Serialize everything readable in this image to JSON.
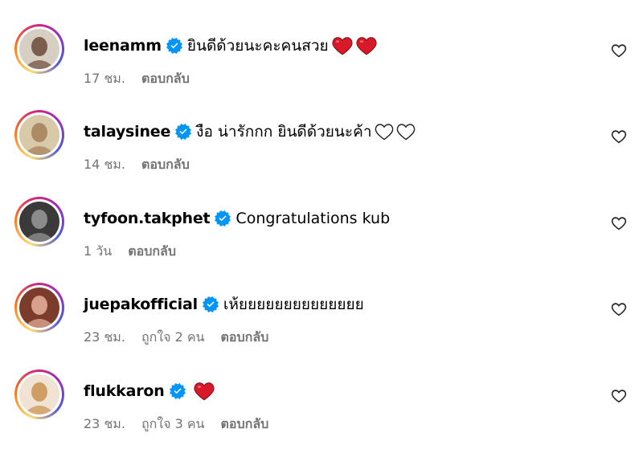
{
  "comments": [
    {
      "username": "leenamm",
      "text": "ยินดีด้วยนะคะคนสวย",
      "red_hearts": 2,
      "white_hearts": 0,
      "time": "17 ชม.",
      "likes": "",
      "reply": "ตอบกลับ",
      "avatar_colors": [
        "#d8cfc4",
        "#6b4a3a"
      ]
    },
    {
      "username": "talaysinee",
      "text": "งือ น่ารักกก ยินดีด้วยนะค้า",
      "red_hearts": 0,
      "white_hearts": 2,
      "time": "14 ชม.",
      "likes": "",
      "reply": "ตอบกลับ",
      "avatar_colors": [
        "#d8c9a8",
        "#a37f59"
      ]
    },
    {
      "username": "tyfoon.takphet",
      "text": "Congratulations kub",
      "red_hearts": 0,
      "white_hearts": 0,
      "time": "1 วัน",
      "likes": "",
      "reply": "ตอบกลับ",
      "avatar_colors": [
        "#3a3a3a",
        "#9a9a9a"
      ]
    },
    {
      "username": "juepakofficial",
      "text": "เห้ยยยยยยยยยยยยยย",
      "red_hearts": 0,
      "white_hearts": 0,
      "time": "23 ชม.",
      "likes": "ถูกใจ 2 คน",
      "reply": "ตอบกลับ",
      "avatar_colors": [
        "#7b3c2c",
        "#e7b39c"
      ]
    },
    {
      "username": "flukkaron",
      "text": "",
      "red_hearts": 1,
      "white_hearts": 0,
      "time": "23 ชม.",
      "likes": "ถูกใจ 3 คน",
      "reply": "ตอบกลับ",
      "avatar_colors": [
        "#f0e3d3",
        "#c9924f"
      ]
    }
  ],
  "icons": {
    "verified": "verified-badge-icon",
    "like": "heart-outline-icon",
    "red_heart": "red-heart-emoji",
    "white_heart": "white-heart-emoji"
  },
  "colors": {
    "verified": "#0095f6",
    "meta_text": "#737373",
    "red_heart": "#d7192a"
  }
}
